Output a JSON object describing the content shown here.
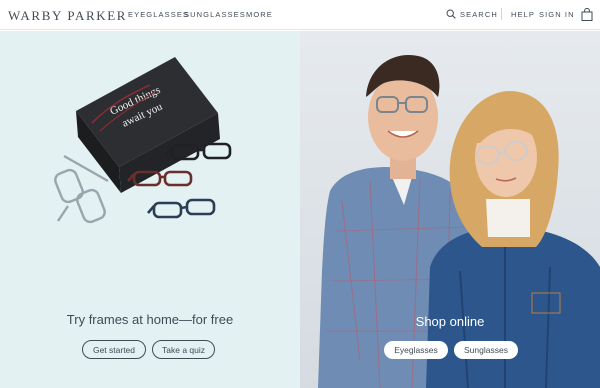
{
  "header": {
    "logo": "WARBY PARKER",
    "nav": {
      "eyeglasses": "EYEGLASSES",
      "sunglasses": "SUNGLASSES",
      "more": "MORE"
    },
    "search_label": "SEARCH",
    "help": "HELP",
    "sign_in": "SIGN IN"
  },
  "left": {
    "box_text_line1": "Good things",
    "box_text_line2": "await you",
    "heading": "Try frames at home—for free",
    "buttons": {
      "get_started": "Get started",
      "quiz": "Take a quiz"
    }
  },
  "right": {
    "heading": "Shop online",
    "buttons": {
      "eyeglasses": "Eyeglasses",
      "sunglasses": "Sunglasses"
    }
  },
  "colors": {
    "text": "#414b56",
    "left_bg": "#e3f1f2",
    "right_bg": "#dfe4e9",
    "accent_shirt": "#2a5a8c"
  },
  "icons": [
    "search-icon",
    "shopping-bag-icon"
  ]
}
